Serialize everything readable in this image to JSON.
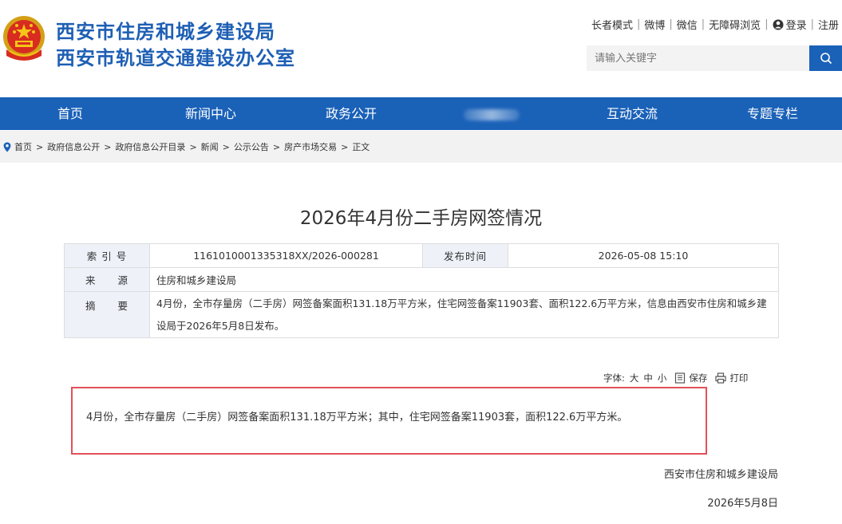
{
  "header": {
    "org_name_1": "西安市住房和城乡建设局",
    "org_name_2": "西安市轨道交通建设办公室",
    "top_links": [
      "长者模式",
      "微博",
      "微信",
      "无障碍浏览"
    ],
    "login_label": "登录",
    "register_label": "注册",
    "search_placeholder": "请输入关键字"
  },
  "nav": {
    "items": [
      "首页",
      "新闻中心",
      "政务公开",
      "",
      "互动交流",
      "专题专栏"
    ]
  },
  "breadcrumb": [
    "首页",
    "政府信息公开",
    "政府信息公开目录",
    "新闻",
    "公示公告",
    "房产市场交易",
    "正文"
  ],
  "article": {
    "title": "2026年4月份二手房网签情况",
    "meta": {
      "index_label": "索 引 号",
      "index_value": "1161010001335318XX/2026-000281",
      "date_label": "发布时间",
      "date_value": "2026-05-08 15:10",
      "source_label": "来　　源",
      "source_value": "住房和城乡建设局",
      "summary_label": "摘　　要",
      "summary_value": "4月份，全市存量房（二手房）网签备案面积131.18万平方米，住宅网签备案11903套、面积122.6万平方米，信息由西安市住房和城乡建设局于2026年5月8日发布。"
    },
    "toolbar": {
      "font_label": "字体:",
      "font_large": "大",
      "font_medium": "中",
      "font_small": "小",
      "save_label": "保存",
      "print_label": "打印"
    },
    "body": "4月份，全市存量房（二手房）网签备案面积131.18万平方米；其中，住宅网签备案11903套，面积122.6万平方米。",
    "signature": "西安市住房和城乡建设局",
    "sign_date": "2026年5月8日"
  },
  "colors": {
    "brand_blue": "#1a61b8",
    "title_blue": "#1e5fb4",
    "highlight_red": "#e2515a"
  },
  "icons": [
    "national-emblem-icon",
    "user-icon",
    "search-icon",
    "location-pin-icon",
    "save-icon",
    "print-icon"
  ]
}
